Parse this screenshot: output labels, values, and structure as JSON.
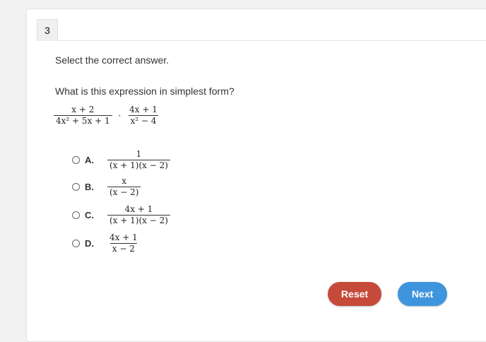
{
  "question": {
    "number": "3",
    "instruction": "Select the correct answer.",
    "prompt": "What is this expression in simplest form?",
    "expression": {
      "left_num": "x + 2",
      "left_den": "4x² + 5x + 1",
      "operator": "·",
      "right_num": "4x + 1",
      "right_den": "x² − 4"
    }
  },
  "choices": [
    {
      "letter": "A.",
      "num": "1",
      "den": "(x + 1)(x − 2)"
    },
    {
      "letter": "B.",
      "num": "x",
      "den": "(x − 2)"
    },
    {
      "letter": "C.",
      "num": "4x + 1",
      "den": "(x + 1)(x − 2)"
    },
    {
      "letter": "D.",
      "num": "4x + 1",
      "den": "x − 2"
    }
  ],
  "buttons": {
    "reset_label": "Reset",
    "next_label": "Next"
  },
  "colors": {
    "reset": "#c64a3a",
    "next": "#3f95dd"
  }
}
